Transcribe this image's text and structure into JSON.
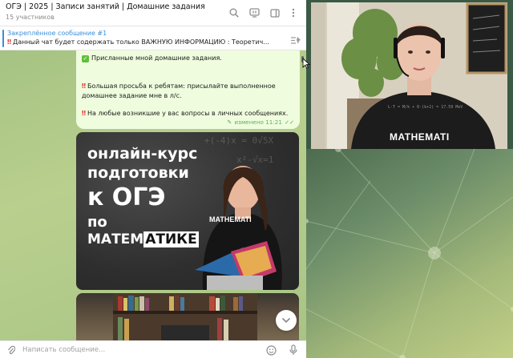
{
  "header": {
    "title": "ОГЭ | 2025 | Записи занятий | Домашние задания",
    "subtitle": "15 участников"
  },
  "pinned": {
    "title": "Закреплённое сообщение #1",
    "text": "Данный чат будет содержать только ВАЖНУЮ ИНФОРМАЦИЮ :   Теоретич..."
  },
  "message": {
    "line1": "Присланные мной домашние задания.",
    "line2": "Большая просьба к ребятам: присылайте выполненное",
    "line3": "домашнее задание мне в л/с.",
    "line4": "На любые возникшие у вас вопросы  в личных сообщениях.",
    "edited_time": "изменено 11:21"
  },
  "promo": {
    "line1": "онлайн-курс",
    "line2": "подготовки",
    "line3": "к ОГЭ",
    "line4": "по",
    "line5a": "МАТЕМ",
    "line5b": "АТИКЕ",
    "shirt": "MATHEMATI"
  },
  "webcam": {
    "shirt_text": "MATHEMATI"
  },
  "composer": {
    "placeholder": "Написать сообщение..."
  },
  "colors": {
    "accent": "#3a8fd8",
    "bubble": "#effdde",
    "edited": "#5fae5f"
  },
  "icons": {
    "search": "search-icon",
    "live": "livestream-icon",
    "sidebar": "sidebar-toggle-icon",
    "menu": "more-vertical-icon",
    "pin_list": "pinned-list-icon",
    "attach": "paperclip-icon",
    "emoji": "emoji-icon",
    "mic": "microphone-icon",
    "scroll": "chevron-down-icon"
  }
}
